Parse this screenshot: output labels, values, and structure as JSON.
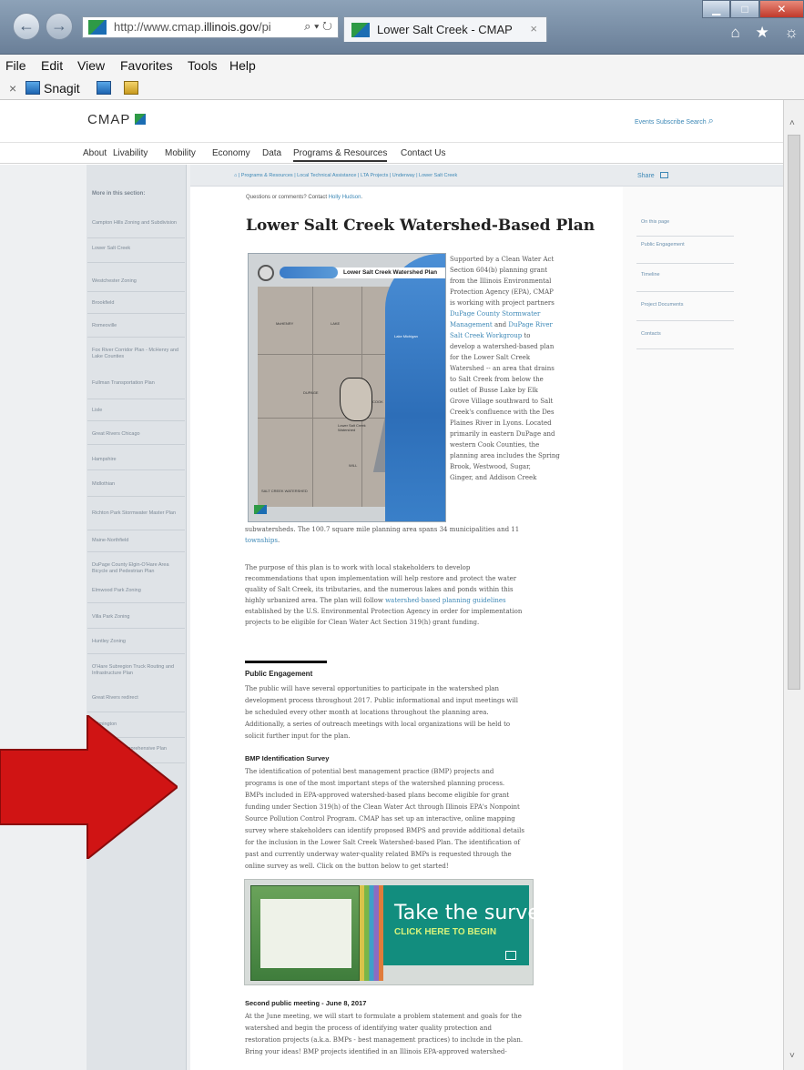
{
  "browser": {
    "url_gray": "http://www.cmap.",
    "url_bold": "illinois.gov",
    "url_end": "/pi",
    "url_tools": "⌕ ▾ ↻",
    "back_icon": "←",
    "forward_icon": "→",
    "tab_title": "Lower Salt Creek - CMAP",
    "tab_close": "×",
    "window_buttons": [
      "▁",
      "□",
      "✕"
    ],
    "toolbar_icons": "⌂ ★ ☼"
  },
  "menubar": {
    "items": [
      "File",
      "Edit",
      "View",
      "Favorites",
      "Tools",
      "Help"
    ]
  },
  "snagit": {
    "close": "×",
    "label": "Snagit"
  },
  "site": {
    "logo": "CMAP",
    "util_links": "Events  Subscribe  Search",
    "search_icon": "⌕",
    "nav": [
      "About",
      "Livability",
      "Mobility",
      "Economy",
      "Data",
      "Programs & Resources",
      "Contact Us"
    ],
    "breadcrumb": "⌂  |  Programs & Resources  |  Local Technical Assistance  |  LTA Projects  |  Underway  |  Lower Salt Creek",
    "share": "Share"
  },
  "sidebar": {
    "heading": "More in this section:",
    "items": [
      "Campton Hills Zoning and Subdivision",
      "Lower Salt Creek",
      "Westchester Zoning",
      "Brookfield",
      "Romeoville",
      "Fox River Corridor Plan - McHenry and Lake Counties",
      "Fullman Transportation Plan",
      "Lisle",
      "Great Rivers Chicago",
      "Hampshire",
      "Midlothian",
      "Richton Park Stormwater Master Plan",
      "Maine-Northfield",
      "DuPage County Elgin-O'Hare Area Bicycle and Pedestrian Plan",
      "Elmwood Park Zoning",
      "Villa Park Zoning",
      "Huntley Zoning",
      "O'Hare Subregion Truck Routing and Infrastructure Plan",
      "Great Rivers redirect",
      "Wilmington",
      "Des Plaines Comprehensive Plan"
    ]
  },
  "on_this_page": {
    "heading": "On this page",
    "items": [
      "Public Engagement",
      "Timeline",
      "Project Documents",
      "Contacts"
    ]
  },
  "content": {
    "questions_prefix": "Questions or comments? Contact ",
    "questions_link": "Holly Hudson",
    "questions_end": ".",
    "title": "Lower Salt Creek Watershed-Based Plan",
    "map": {
      "title": "Lower Salt Creek Watershed Plan",
      "lake_label": "Lake Michigan",
      "label_mchenry": "McHENRY",
      "label_lake": "LAKE",
      "label_cook": "COOK",
      "label_dupage": "DUPAGE",
      "label_will": "WILL",
      "label_lsc": "Lower Salt Creek Watershed",
      "label_footer": "SALT CREEK WATERSHED"
    },
    "intro_lines": [
      "Supported by a Clean Water Act",
      "Section 604(b) planning grant",
      "from the Illinois Environmental",
      "Protection Agency (EPA), CMAP",
      "is working with project partners"
    ],
    "intro_link1a": "DuPage County Stormwater",
    "intro_link1b": "Management",
    "intro_and": " and ",
    "intro_link2a": "DuPage River",
    "intro_link2b": "Salt Creek Workgroup",
    "intro_to": " to",
    "intro_rest": [
      "develop a watershed-based plan",
      "for the Lower Salt Creek",
      "Watershed -- an area that drains",
      "to Salt Creek from below the",
      "outlet of Busse Lake by Elk",
      "Grove Village southward to Salt",
      "Creek's confluence with the Des",
      "Plaines River in Lyons.  Located",
      "primarily in eastern DuPage and",
      "western Cook Counties, the",
      "planning area includes the Spring",
      "Brook, Westwood, Sugar,",
      "Ginger, and Addison Creek"
    ],
    "intro_full1": "subwatersheds.  The 100.7 square mile planning area spans 34 municipalities and 11",
    "intro_full2_link": "townships",
    "intro_full2_end": ".",
    "purpose_lines": [
      "The purpose of this plan is to work with local stakeholders to develop",
      "recommendations that upon implementation will help restore and protect the water",
      "quality of Salt Creek, its tributaries, and the numerous lakes and ponds within this"
    ],
    "purpose_l4_pre": "highly urbanized area.  The plan will follow ",
    "purpose_l4_link": "watershed-based planning guidelines",
    "purpose_lines2": [
      "established by the U.S. Environmental Protection Agency in order for implementation",
      "projects to be eligible for Clean Water Act Section 319(h) grant funding."
    ],
    "public_head": "Public Engagement",
    "public_lines": [
      "The public will have several opportunities to participate in the watershed plan",
      "development process throughout 2017.  Public informational and input meetings will",
      "be scheduled every other month at locations throughout the planning area.",
      "Additionally, a series of outreach meetings with local organizations will be held to",
      "solicit further input for the plan."
    ],
    "bmp_head": "BMP Identification Survey",
    "bmp_lines": [
      "The identification of potential best management practice (BMP) projects and",
      "programs is one of the most important steps of the watershed planning process.",
      "BMPs included in EPA-approved watershed-based plans become eligible for grant",
      "funding under Section 319(h) of the Clean Water Act through Illinois EPA's Nonpoint",
      "Source Pollution Control Program.  CMAP has set up an interactive, online mapping",
      "survey where stakeholders can identify proposed BMPS and provide additional details",
      "for the inclusion in the Lower Salt Creek Watershed-based Plan.  The identification of",
      "past and currently underway water-quality related BMPs is requested through the",
      "online survey as well.  Click on the button below to get started!"
    ],
    "survey_main": "Take the survey",
    "survey_sub": "CLICK HERE TO BEGIN",
    "meeting_head": "Second public meeting - June 8, 2017",
    "meeting_lines": [
      "At the June meeting, we will start to formulate a problem statement and goals for the",
      "watershed and begin the process of identifying water quality protection and",
      "restoration projects (a.k.a. BMPs - best management practices) to include in the plan.",
      "Bring your ideas!  BMP projects identified in an Illinois EPA-approved watershed-"
    ]
  },
  "scrollbar": {
    "up": "˄",
    "down": "˅"
  },
  "colors": {
    "slide_background": "#1a2a8c",
    "arrow": "#d01414",
    "link": "#3d88b6",
    "survey_teal": "#128d7e"
  }
}
